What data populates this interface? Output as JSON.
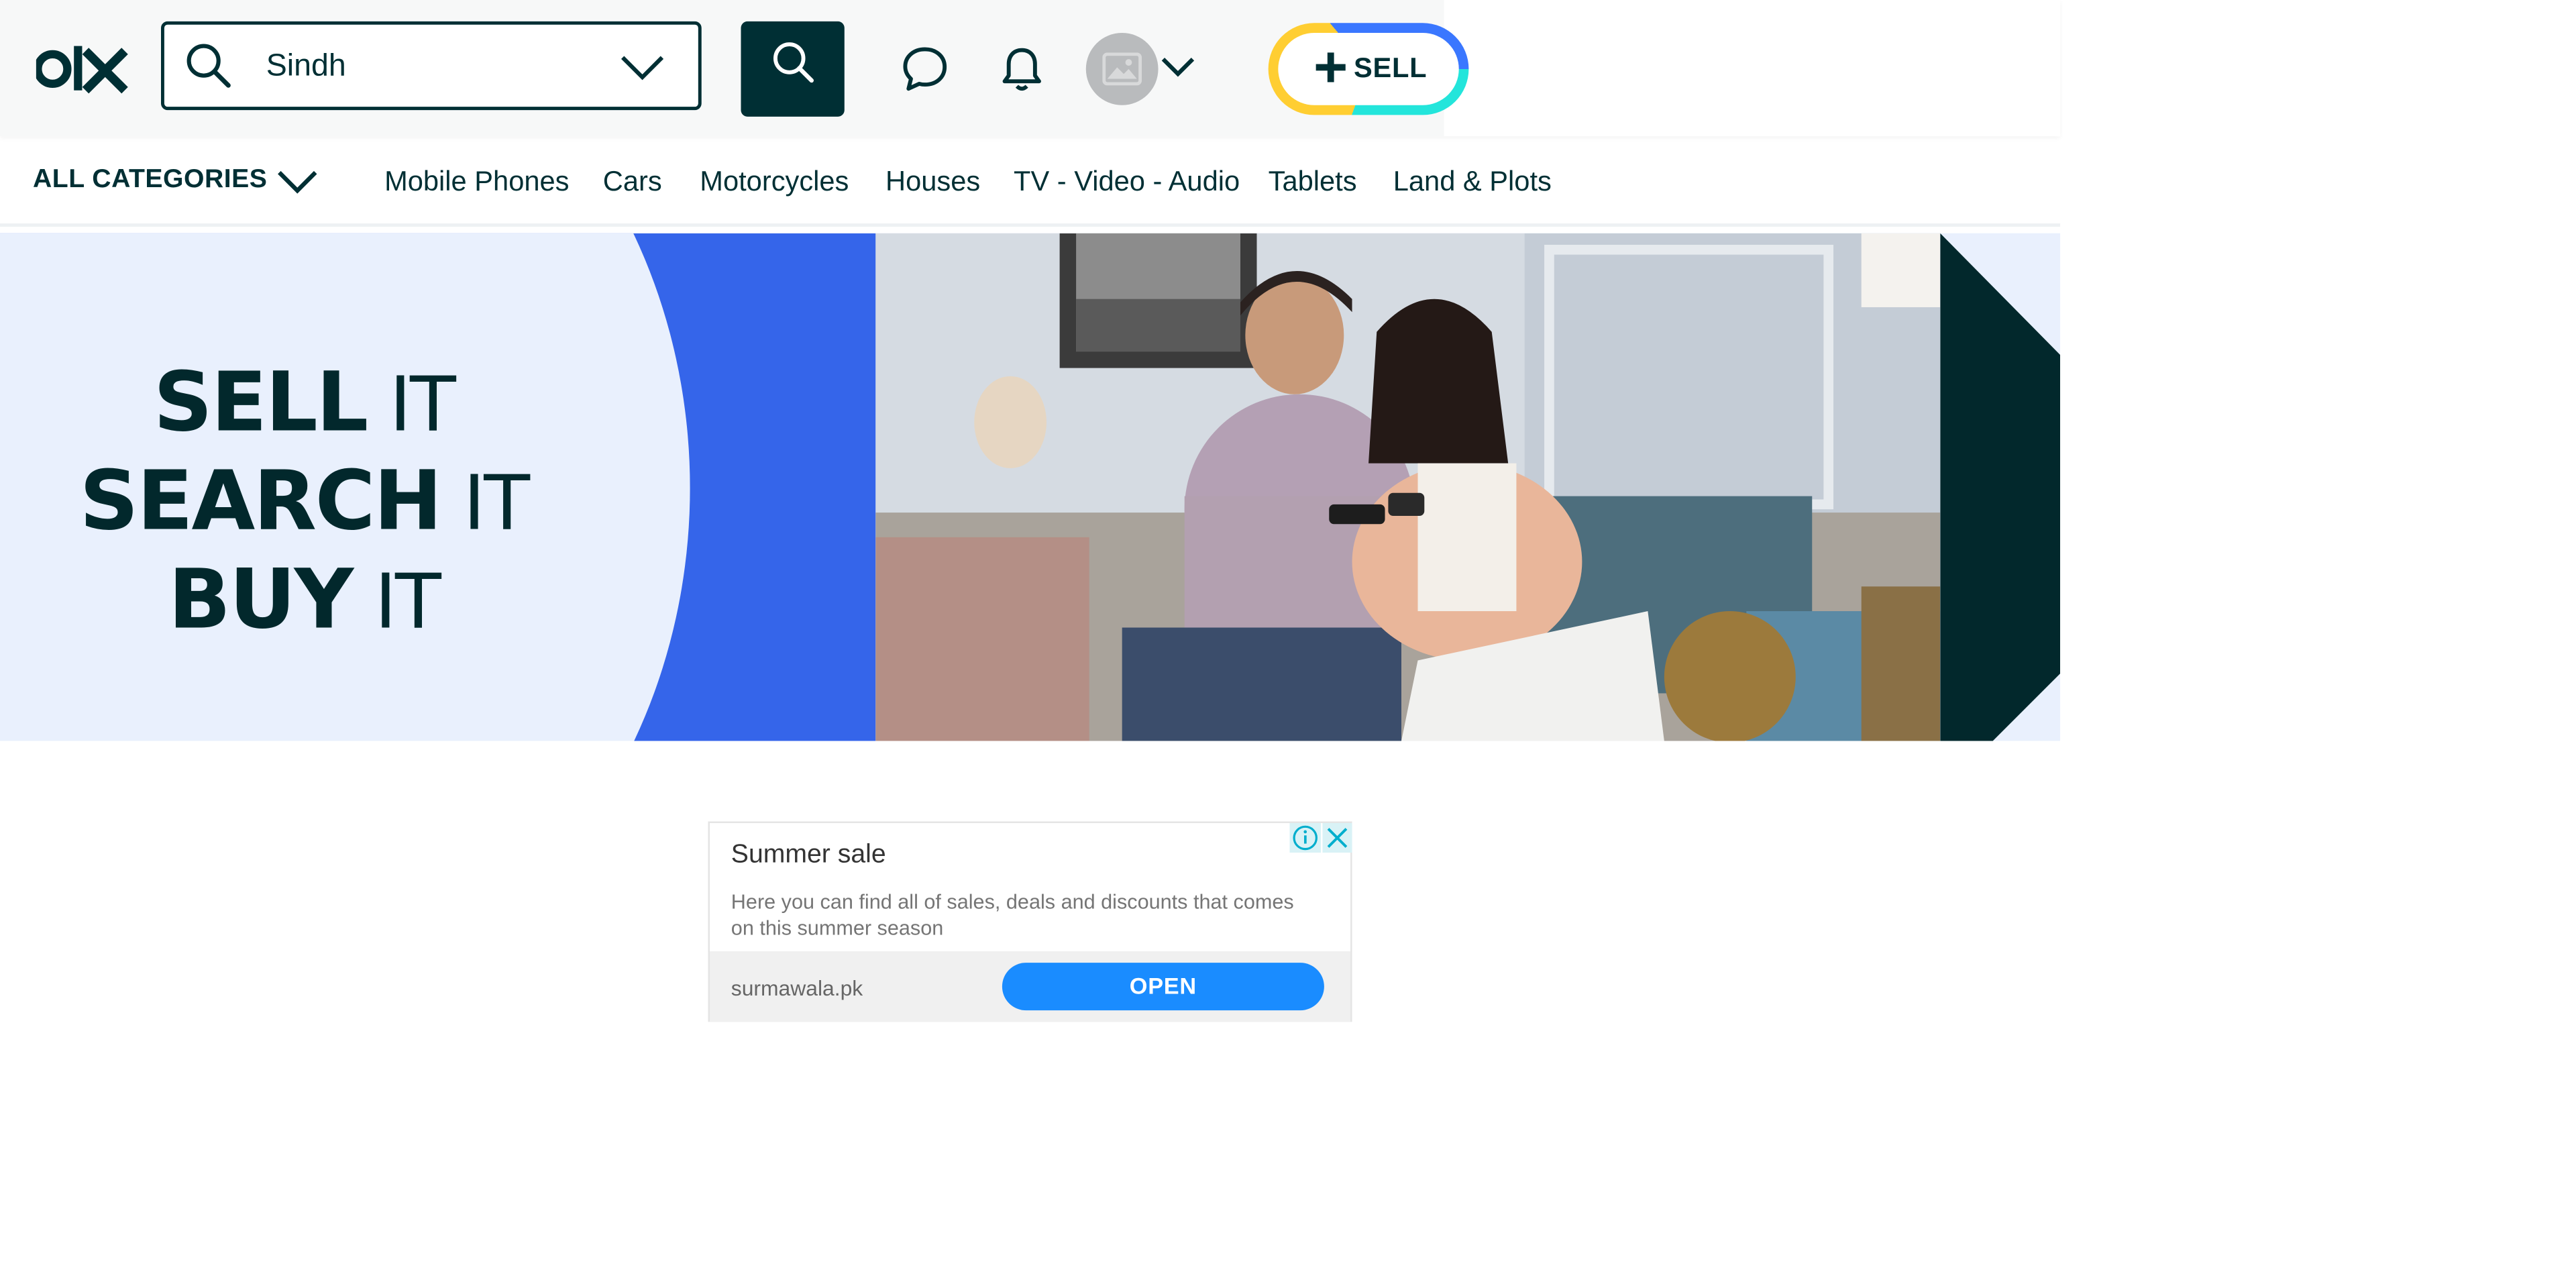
{
  "header": {
    "logo_text": "olx",
    "search": {
      "location_value": "Sindh"
    },
    "sell_label": "SELL"
  },
  "categories": {
    "all_label": "ALL CATEGORIES",
    "items": [
      "Mobile Phones",
      "Cars",
      "Motorcycles",
      "Houses",
      "TV - Video - Audio",
      "Tablets",
      "Land & Plots"
    ]
  },
  "hero": {
    "line1_bold": "SELL",
    "line1_thin": " IT",
    "line2_bold": "SEARCH",
    "line2_thin": " IT",
    "line3_bold": "BUY",
    "line3_thin": " IT"
  },
  "ad": {
    "title": "Summer sale",
    "description": "Here you can find all of sales, deals and discounts that comes on this summer season",
    "domain": "surmawala.pk",
    "cta": "OPEN"
  },
  "colors": {
    "brand_dark": "#002f34",
    "hero_blue": "#3565ea",
    "hero_light": "#e9f0fd",
    "ad_button": "#1a8cff",
    "sell_yellow": "#ffce32",
    "sell_blue": "#3a77ff",
    "sell_teal": "#23e5db"
  }
}
